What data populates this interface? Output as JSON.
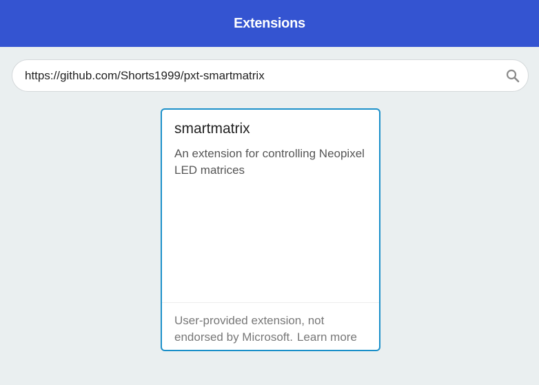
{
  "header": {
    "title": "Extensions"
  },
  "search": {
    "value": "https://github.com/Shorts1999/pxt-smartmatrix",
    "icon": "search-icon"
  },
  "card": {
    "title": "smartmatrix",
    "description": "An extension for controlling Neopixel LED matrices",
    "footer_text": "User-provided extension, not endorsed by Microsoft.",
    "learn_more": "Learn more"
  },
  "colors": {
    "header_bg": "#3454d1",
    "page_bg": "#eaeff0",
    "card_border": "#1a8fc9"
  }
}
